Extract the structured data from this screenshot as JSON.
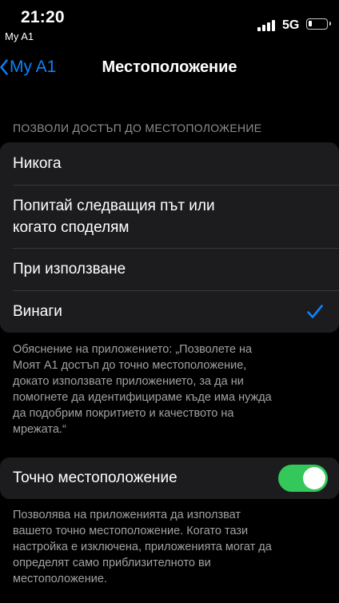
{
  "status": {
    "time": "21:20",
    "back_app": "My A1",
    "network": "5G"
  },
  "nav": {
    "back_label": "My A1",
    "title": "Местоположение"
  },
  "section_header": "ПОЗВОЛИ ДОСТЪП ДО МЕСТОПОЛОЖЕНИЕ",
  "options": [
    {
      "label": "Никога",
      "selected": false
    },
    {
      "label": "Попитай следващия път или",
      "label2": "когато споделям",
      "selected": false
    },
    {
      "label": "При използване",
      "selected": false
    },
    {
      "label": "Винаги",
      "selected": true
    }
  ],
  "explanation": {
    "lines": [
      "Обяснение на приложението: „Позволете на",
      "Моят А1 достъп до точно местоположение,",
      "докато използвате приложението, за да ни",
      "помогнете да идентифицираме къде има нужда",
      "да подобрим покритието и качеството на",
      "мрежата.“"
    ]
  },
  "precise": {
    "label": "Точно местоположение",
    "enabled": true,
    "footer_lines": [
      "Позволява на приложенията да използват",
      "вашето точно местоположение. Когато тази",
      "настройка е изключена, приложенията могат да",
      "определят само приблизителното ви",
      "местоположение."
    ]
  },
  "colors": {
    "accent": "#0a84ff",
    "toggle_on": "#34c759",
    "group_bg": "#1c1c1e"
  }
}
